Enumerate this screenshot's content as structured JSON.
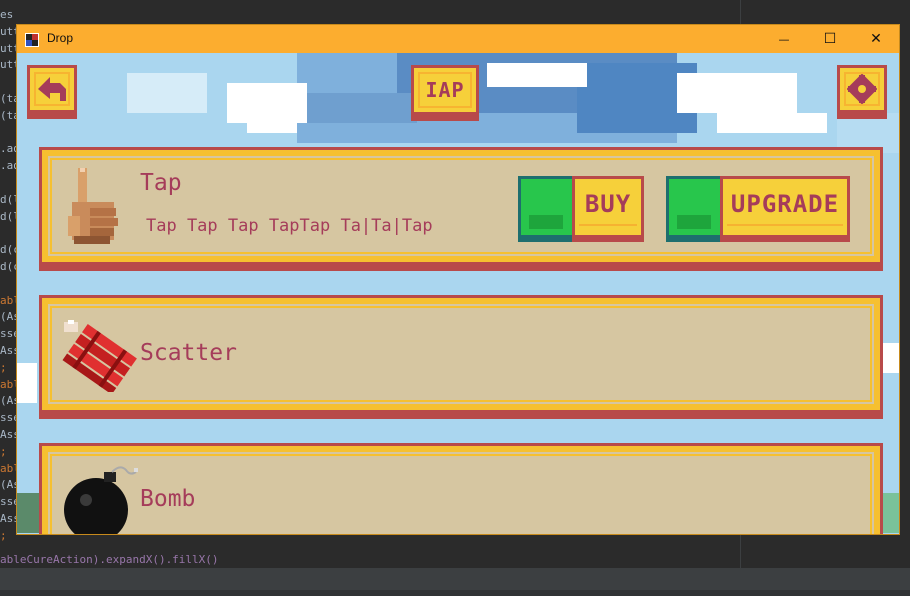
{
  "ide": {
    "lines": [
      {
        "text": "es",
        "cls": ""
      },
      {
        "text": "utt",
        "cls": ""
      },
      {
        "text": "utt",
        "cls": ""
      },
      {
        "text": "utt",
        "cls": ""
      },
      {
        "text": "",
        "cls": ""
      },
      {
        "text": "(ta",
        "cls": ""
      },
      {
        "text": "(ta",
        "cls": ""
      },
      {
        "text": "",
        "cls": ""
      },
      {
        "text": ".ad",
        "cls": ""
      },
      {
        "text": ".ad",
        "cls": ""
      },
      {
        "text": "",
        "cls": ""
      },
      {
        "text": "d(l",
        "cls": ""
      },
      {
        "text": "d(l",
        "cls": ""
      },
      {
        "text": "",
        "cls": ""
      },
      {
        "text": "d(c",
        "cls": ""
      },
      {
        "text": "d(c",
        "cls": ""
      },
      {
        "text": "",
        "cls": ""
      },
      {
        "text": "abl",
        "cls": "yellow"
      },
      {
        "text": "(As",
        "cls": ""
      },
      {
        "text": "sse",
        "cls": ""
      },
      {
        "text": "Ass",
        "cls": ""
      },
      {
        "text": ";",
        "cls": "yellow"
      },
      {
        "text": "abl",
        "cls": "yellow"
      },
      {
        "text": "(As",
        "cls": ""
      },
      {
        "text": "sse",
        "cls": ""
      },
      {
        "text": "Ass",
        "cls": ""
      },
      {
        "text": ";",
        "cls": "yellow"
      },
      {
        "text": "abl",
        "cls": "yellow"
      },
      {
        "text": "(As",
        "cls": ""
      },
      {
        "text": "sse",
        "cls": ""
      },
      {
        "text": "Ass",
        "cls": ""
      },
      {
        "text": ";",
        "cls": "yellow"
      }
    ],
    "bottom_line": "ableCureAction).expandX().fillX()"
  },
  "window": {
    "title": "Drop",
    "minimize": "—",
    "maximize": "☐",
    "close": "✕"
  },
  "toolbar": {
    "back_icon": "back-arrow-icon",
    "iap_label": "IAP",
    "settings_icon": "gear-icon"
  },
  "cards": [
    {
      "title": "Tap",
      "icon": "hand-icon",
      "tap_strip": "Tap Tap Tap  TapTap Ta|Ta|Tap",
      "buy_label": "BUY",
      "upgrade_label": "UPGRADE"
    },
    {
      "title": "Scatter",
      "icon": "dynamite-icon"
    },
    {
      "title": "Bomb",
      "icon": "bomb-icon"
    }
  ],
  "colors": {
    "window_frame": "#fcad2f",
    "sky": "#aad6ef",
    "card_bg": "#d6c6a1",
    "card_border": "#b84a4a",
    "frame_yellow": "#f6c030",
    "text_maroon": "#a53c5a",
    "green": "#28c64c"
  }
}
